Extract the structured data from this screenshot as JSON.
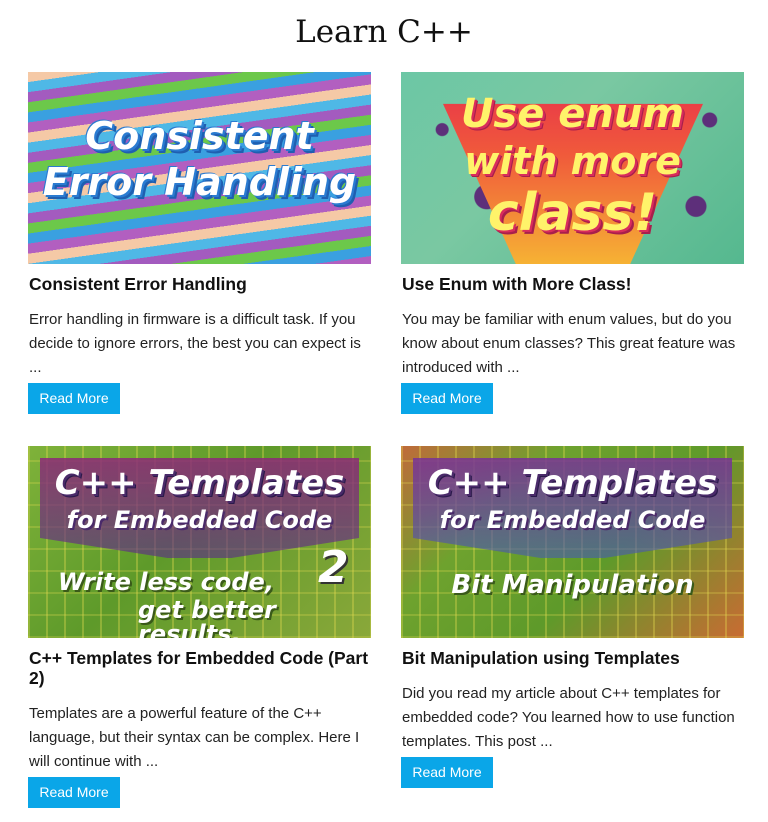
{
  "page": {
    "title": "Learn C++"
  },
  "colors": {
    "button": "#0aa6e8",
    "button_text": "#ffffff"
  },
  "posts": [
    {
      "title": "Consistent Error Handling",
      "excerpt": "Error handling in firmware is a difficult task. If you decide to ignore errors, the best you can expect is ...",
      "button": "Read More",
      "thumb": {
        "line1": "Consistent",
        "line2": "Error Handling"
      }
    },
    {
      "title": "Use Enum with More Class!",
      "excerpt": "You may be familiar with enum values, but do you know about enum classes? This great feature was introduced with ...",
      "button": "Read More",
      "thumb": {
        "line1": "Use enum",
        "line2": "with more",
        "line3": "class!"
      }
    },
    {
      "title": "C++ Templates for Embedded Code (Part 2)",
      "excerpt": "Templates are a powerful feature of the C++ language, but their syntax can be complex. Here I will continue with ...",
      "button": "Read More",
      "thumb": {
        "line1": "C++ Templates",
        "line2": "for Embedded Code",
        "line3": "Write less code,",
        "line4": "get better results.",
        "number": "2"
      }
    },
    {
      "title": "Bit Manipulation using Templates",
      "excerpt": "Did you read my article about C++ templates for embedded code? You learned how to use function templates. This post ...",
      "button": "Read More",
      "thumb": {
        "line1": "C++ Templates",
        "line2": "for Embedded Code",
        "line3": "Bit Manipulation"
      }
    }
  ]
}
